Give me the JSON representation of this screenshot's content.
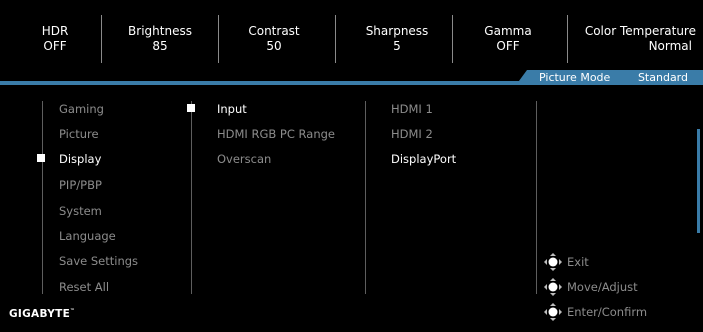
{
  "status_bar": [
    {
      "label": "HDR",
      "value": "OFF"
    },
    {
      "label": "Brightness",
      "value": "85"
    },
    {
      "label": "Contrast",
      "value": "50"
    },
    {
      "label": "Sharpness",
      "value": "5"
    },
    {
      "label": "Gamma",
      "value": "OFF"
    },
    {
      "label": "Color Temperature",
      "value": "Normal"
    }
  ],
  "picture_mode": {
    "label": "Picture Mode",
    "value": "Standard"
  },
  "main_menu": [
    {
      "label": "Gaming",
      "selected": false
    },
    {
      "label": "Picture",
      "selected": false
    },
    {
      "label": "Display",
      "selected": true
    },
    {
      "label": "PIP/PBP",
      "selected": false
    },
    {
      "label": "System",
      "selected": false
    },
    {
      "label": "Language",
      "selected": false
    },
    {
      "label": "Save Settings",
      "selected": false
    },
    {
      "label": "Reset All",
      "selected": false
    }
  ],
  "sub_menu": [
    {
      "label": "Input",
      "selected": true
    },
    {
      "label": "HDMI RGB PC Range",
      "selected": false
    },
    {
      "label": "Overscan",
      "selected": false
    }
  ],
  "options": [
    {
      "label": "HDMI 1",
      "active": false
    },
    {
      "label": "HDMI 2",
      "active": false
    },
    {
      "label": "DisplayPort",
      "active": true
    }
  ],
  "hints": [
    {
      "icon": "joystick-icon",
      "label": "Exit"
    },
    {
      "icon": "joystick-icon",
      "label": "Move/Adjust"
    },
    {
      "icon": "joystick-icon",
      "label": "Enter/Confirm"
    }
  ],
  "brand": {
    "logo": "GIGABYTE",
    "tm": "™"
  },
  "colors": {
    "accent": "#3a7ca8",
    "dim_text": "#8c8c8c",
    "background": "#000000"
  }
}
